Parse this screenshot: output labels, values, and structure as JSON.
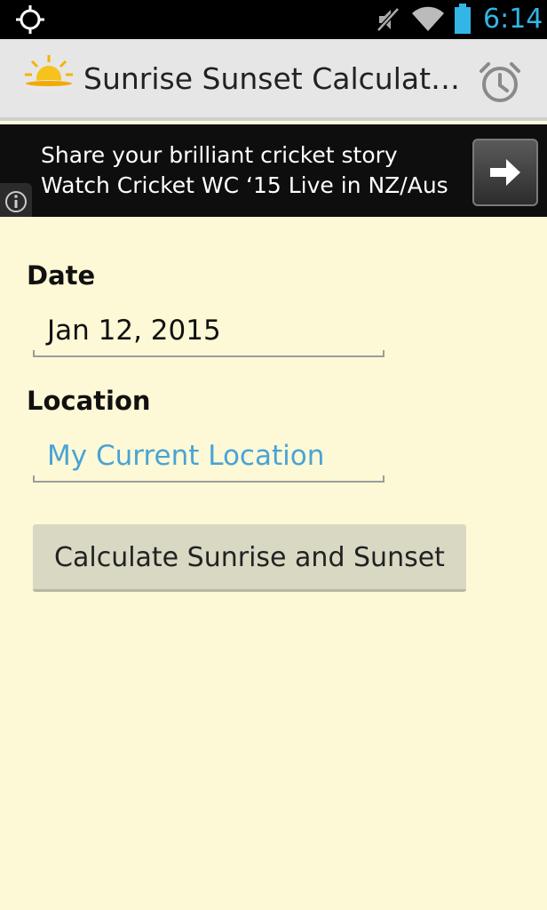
{
  "status_bar": {
    "time": "6:14",
    "icons": [
      "gps-icon",
      "mute-icon",
      "wifi-icon",
      "battery-icon"
    ],
    "time_color": "#33b5e5"
  },
  "action_bar": {
    "title": "Sunrise Sunset Calculat…",
    "app_icon": "sun-cloud-icon",
    "action_icon": "alarm-clock-icon"
  },
  "ad": {
    "text": "Share your brilliant cricket story Watch Cricket WC ‘15 Live in NZ/Aus",
    "info_icon": "info-icon",
    "arrow_icon": "arrow-right-icon"
  },
  "form": {
    "date_label": "Date",
    "date_value": "Jan 12, 2015",
    "location_label": "Location",
    "location_value": "My Current Location",
    "location_color": "#4aa3d6",
    "calculate_label": "Calculate Sunrise and Sunset"
  },
  "colors": {
    "background": "#fdf9d6",
    "action_bar": "#e6e6e6",
    "ad_background": "#0e0e0e",
    "button": "#d9d8c3"
  }
}
